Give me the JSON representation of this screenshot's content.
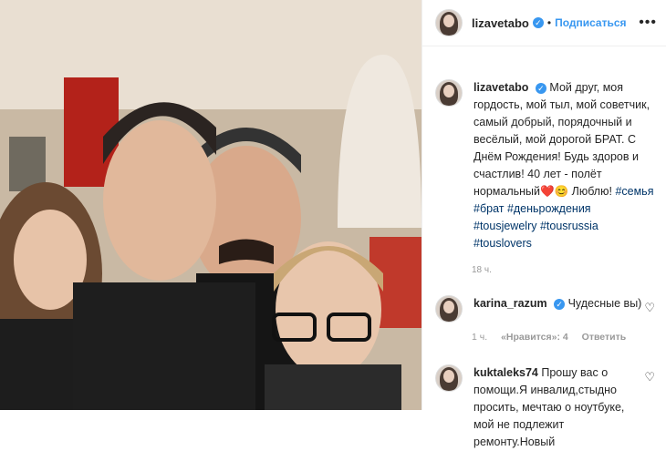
{
  "post": {
    "username": "lizavetabo",
    "follow_label": "Подписаться",
    "separator": "•",
    "more_label": "•••",
    "verified_glyph": "✓",
    "caption": "Мой друг, моя гордость, мой тыл, мой советчик, самый добрый, порядочный и весёлый, мой дорогой БРАТ. С Днём Рождения! Будь здоров и счастлив! 40 лет - полёт нормальный❤️😊 Люблю!",
    "hashtags": "#семья #брат #деньрождения #tousjewelry #tousrussia #touslovers",
    "time": "18 ч."
  },
  "comments": [
    {
      "username": "karina_razum",
      "text": "Чудесные вы)",
      "time": "1 ч.",
      "likes": "«Нравится»: 4",
      "reply": "Ответить"
    },
    {
      "username": "kuktaleks74",
      "text": "Прошу вас о помощи.Я инвалид,стыдно просить, мечтаю о ноутбуке, мой не подлежит ремонту.Новый"
    }
  ],
  "icons": {
    "heart": "♡"
  }
}
